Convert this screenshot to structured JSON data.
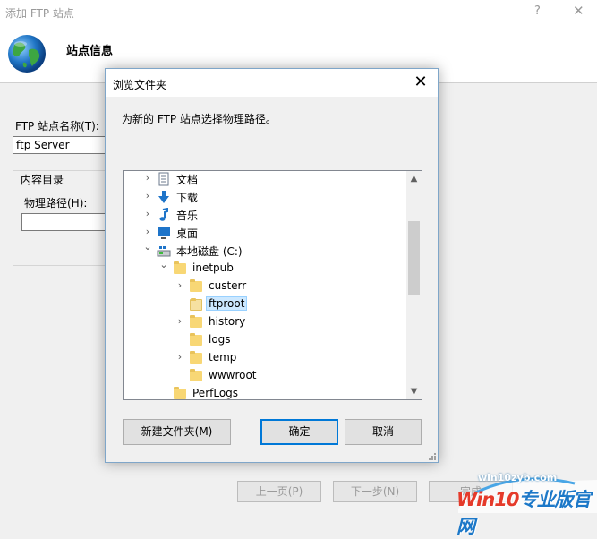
{
  "wizard": {
    "title": "添加 FTP 站点",
    "help": "?",
    "close": "✕",
    "header_title": "站点信息",
    "site_name_label": "FTP 站点名称(T):",
    "site_name_value": "ftp Server",
    "content_dir_label": "内容目录",
    "physical_path_label": "物理路径(H):",
    "physical_path_value": "",
    "prev_button": "上一页(P)",
    "next_button": "下一步(N)",
    "finish_button": "完成"
  },
  "dialog": {
    "title": "浏览文件夹",
    "close": "✕",
    "description": "为新的 FTP 站点选择物理路径。",
    "tree": [
      {
        "label": "文档",
        "icon": "document-icon",
        "expander": "›"
      },
      {
        "label": "下载",
        "icon": "download-icon",
        "expander": "›"
      },
      {
        "label": "音乐",
        "icon": "music-icon",
        "expander": "›"
      },
      {
        "label": "桌面",
        "icon": "desktop-icon",
        "expander": "›"
      },
      {
        "label": "本地磁盘 (C:)",
        "icon": "drive-icon",
        "expander": "⌄"
      },
      {
        "label": "inetpub",
        "icon": "folder-icon",
        "expander": "⌄"
      },
      {
        "label": "custerr",
        "icon": "folder-icon",
        "expander": "›"
      },
      {
        "label": "ftproot",
        "icon": "folder-open-icon",
        "expander": "",
        "selected": true
      },
      {
        "label": "history",
        "icon": "folder-icon",
        "expander": "›"
      },
      {
        "label": "logs",
        "icon": "folder-icon",
        "expander": ""
      },
      {
        "label": "temp",
        "icon": "folder-icon",
        "expander": "›"
      },
      {
        "label": "wwwroot",
        "icon": "folder-icon",
        "expander": ""
      },
      {
        "label": "PerfLogs",
        "icon": "folder-icon",
        "expander": ""
      }
    ],
    "new_folder_button": "新建文件夹(M)",
    "ok_button": "确定",
    "cancel_button": "取消"
  },
  "watermark": {
    "small": "win10zyb.com",
    "big_a": "Win10",
    "big_b": "专业版官网"
  },
  "colors": {
    "accent": "#0078d7",
    "selection": "#cce8ff",
    "folder": "#f8d775"
  }
}
